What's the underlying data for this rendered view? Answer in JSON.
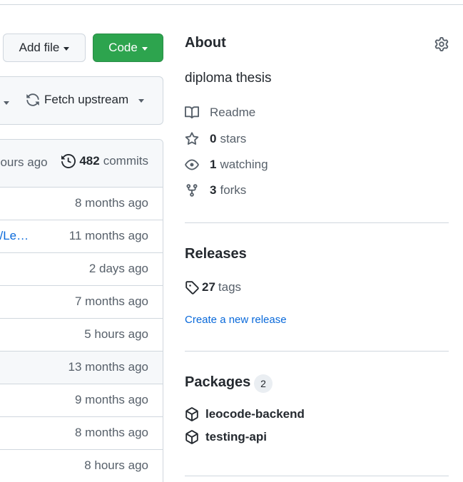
{
  "toolbar": {
    "add_file_label": "Add file",
    "code_label": "Code"
  },
  "sync": {
    "fetch_upstream_label": "Fetch upstream"
  },
  "file_list": {
    "latest_commit_time": "hours ago",
    "commits_count": "482",
    "commits_label": "commits",
    "rows": [
      {
        "message": "",
        "time": "8 months ago"
      },
      {
        "message": "s/Le…",
        "time": "11 months ago"
      },
      {
        "message": "",
        "time": "2 days ago"
      },
      {
        "message": "",
        "time": "7 months ago"
      },
      {
        "message": "",
        "time": "5 hours ago"
      },
      {
        "message": "",
        "time": "13 months ago"
      },
      {
        "message": "",
        "time": "9 months ago"
      },
      {
        "message": "",
        "time": "8 months ago"
      },
      {
        "message": "",
        "time": "8 hours ago"
      }
    ]
  },
  "about": {
    "title": "About",
    "description": "diploma thesis",
    "readme_label": "Readme",
    "stars_count": "0",
    "stars_label": "stars",
    "watching_count": "1",
    "watching_label": "watching",
    "forks_count": "3",
    "forks_label": "forks"
  },
  "releases": {
    "title": "Releases",
    "tags_count": "27",
    "tags_label": "tags",
    "create_release_label": "Create a new release"
  },
  "packages": {
    "title": "Packages",
    "count": "2",
    "items": [
      {
        "name": "leocode-backend"
      },
      {
        "name": "testing-api"
      }
    ]
  },
  "colors": {
    "accent_link": "#0969da",
    "primary_button": "#2da44e",
    "border": "#d0d7de",
    "muted_text": "#57606a"
  },
  "icons": [
    "caret-down-icon",
    "sync-icon",
    "history-icon",
    "gear-icon",
    "book-icon",
    "star-icon",
    "eye-icon",
    "fork-icon",
    "tag-icon",
    "package-icon"
  ]
}
